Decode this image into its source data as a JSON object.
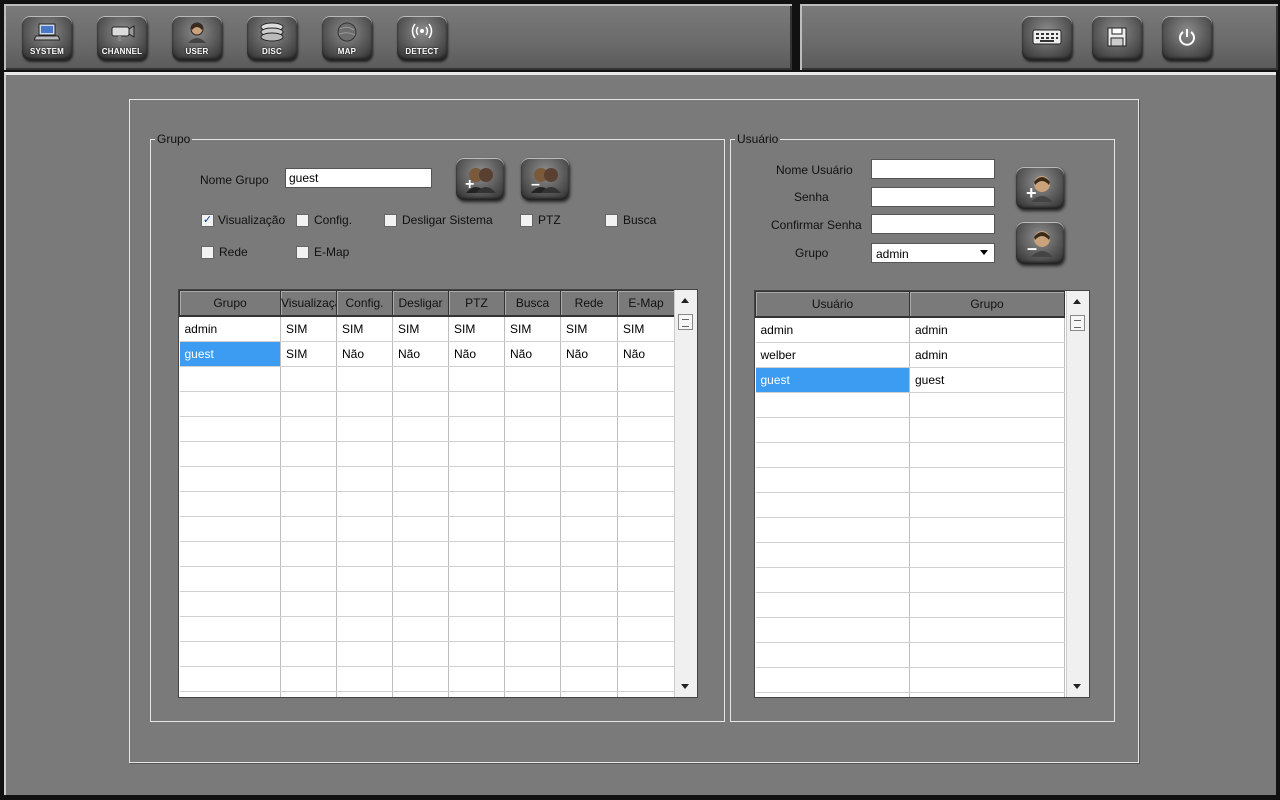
{
  "toolbar": {
    "buttons": [
      {
        "label": "SYSTEM",
        "icon": "laptop-icon"
      },
      {
        "label": "CHANNEL",
        "icon": "camera-icon"
      },
      {
        "label": "USER",
        "icon": "user-icon"
      },
      {
        "label": "DISC",
        "icon": "disc-icon"
      },
      {
        "label": "MAP",
        "icon": "map-icon"
      },
      {
        "label": "DETECT",
        "icon": "detect-icon"
      }
    ],
    "right_buttons": [
      {
        "icon": "keyboard-icon"
      },
      {
        "icon": "save-icon"
      },
      {
        "icon": "power-icon"
      }
    ]
  },
  "group_panel": {
    "legend": "Grupo",
    "name_label": "Nome Grupo",
    "name_value": "guest",
    "permissions": [
      {
        "label": "Visualização",
        "checked": true
      },
      {
        "label": "Config.",
        "checked": false
      },
      {
        "label": "Desligar Sistema",
        "checked": false
      },
      {
        "label": "PTZ",
        "checked": false
      },
      {
        "label": "Busca",
        "checked": false
      },
      {
        "label": "Rede",
        "checked": false
      },
      {
        "label": "E-Map",
        "checked": false
      }
    ],
    "table": {
      "columns": [
        "Grupo",
        "Visualização",
        "Config.",
        "Desligar",
        "PTZ",
        "Busca",
        "Rede",
        "E-Map"
      ],
      "rows": [
        [
          "admin",
          "SIM",
          "SIM",
          "SIM",
          "SIM",
          "SIM",
          "SIM",
          "SIM"
        ],
        [
          "guest",
          "SIM",
          "Não",
          "Não",
          "Não",
          "Não",
          "Não",
          "Não"
        ]
      ],
      "selected_row": 1
    }
  },
  "user_panel": {
    "legend": "Usuário",
    "username_label": "Nome Usuário",
    "username_value": "",
    "password_label": "Senha",
    "password_value": "",
    "confirm_label": "Confirmar Senha",
    "confirm_value": "",
    "group_label": "Grupo",
    "group_value": "admin",
    "table": {
      "columns": [
        "Usuário",
        "Grupo"
      ],
      "rows": [
        [
          "admin",
          "admin"
        ],
        [
          "welber",
          "admin"
        ],
        [
          "guest",
          "guest"
        ]
      ],
      "selected_row": 2
    }
  },
  "colors": {
    "selection": "#3b9cf2",
    "panel": "#7a7a7a"
  }
}
